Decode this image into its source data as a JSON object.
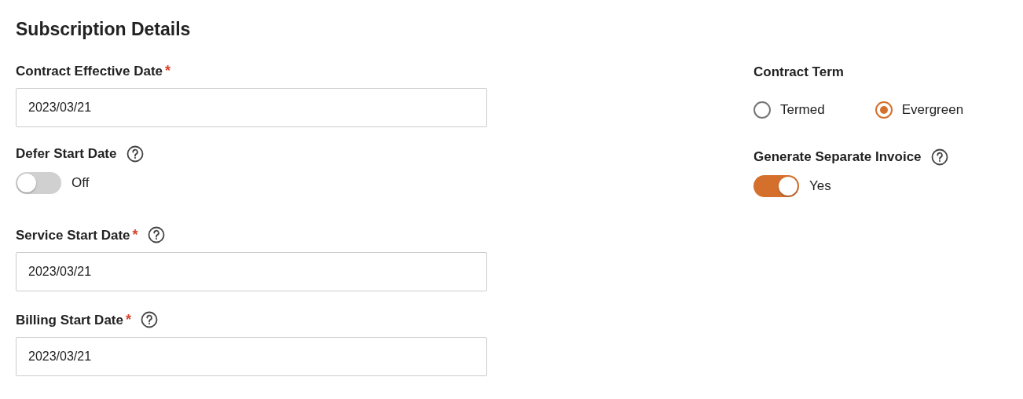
{
  "title": "Subscription Details",
  "left": [
    {
      "kind": "date",
      "label": "Contract Effective Date",
      "required_mark": "*",
      "help": false,
      "value": "2023/03/21"
    },
    {
      "kind": "toggle",
      "label": "Defer Start Date",
      "help": true,
      "on": false,
      "state_text": "Off"
    },
    {
      "kind": "date",
      "label": "Service Start Date",
      "required_mark": "*",
      "help": true,
      "value": "2023/03/21"
    },
    {
      "kind": "date",
      "label": "Billing Start Date",
      "required_mark": "*",
      "help": true,
      "value": "2023/03/21"
    }
  ],
  "right": [
    {
      "kind": "radio",
      "label": "Contract Term",
      "help": false,
      "options": [
        {
          "label": "Termed",
          "selected": false
        },
        {
          "label": "Evergreen",
          "selected": true
        }
      ]
    },
    {
      "kind": "toggle",
      "label": "Generate Separate Invoice",
      "help": true,
      "on": true,
      "state_text": "Yes"
    }
  ]
}
